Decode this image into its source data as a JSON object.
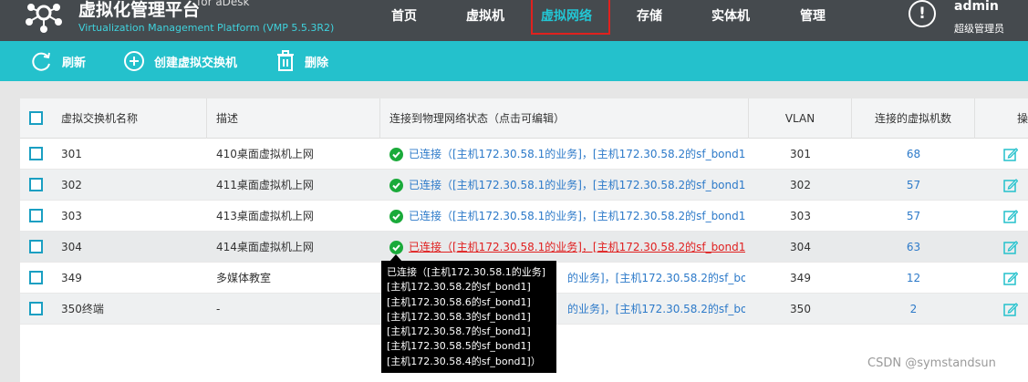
{
  "header": {
    "title": "虚拟化管理平台",
    "title_suffix": "for aDesk",
    "subtitle": "Virtualization Management Platform (VMP 5.5.3R2)",
    "nav": [
      "首页",
      "虚拟机",
      "虚拟网络",
      "存储",
      "实体机",
      "管理"
    ],
    "active_nav": "虚拟网络",
    "alert_symbol": "!",
    "user_name": "admin",
    "user_role": "超级管理员"
  },
  "toolbar": {
    "refresh_label": "刷新",
    "create_label": "创建虚拟交换机",
    "delete_label": "删除"
  },
  "table": {
    "columns": [
      "虚拟交换机名称",
      "描述",
      "连接到物理网络状态（点击可编辑）",
      "VLAN",
      "连接的虚拟机数",
      "操"
    ],
    "rows": [
      {
        "name": "301",
        "desc": "410桌面虚拟机上网",
        "status": "已连接（[主机172.30.58.1的业务]，[主机172.30.58.2的sf_bond1...",
        "vlan": "301",
        "vm_count": "68"
      },
      {
        "name": "302",
        "desc": "411桌面虚拟机上网",
        "status": "已连接（[主机172.30.58.1的业务]，[主机172.30.58.2的sf_bond1...",
        "vlan": "302",
        "vm_count": "57"
      },
      {
        "name": "303",
        "desc": "413桌面虚拟机上网",
        "status": "已连接（[主机172.30.58.1的业务]，[主机172.30.58.2的sf_bond1...",
        "vlan": "303",
        "vm_count": "57"
      },
      {
        "name": "304",
        "desc": "414桌面虚拟机上网",
        "status": "已连接（[主机172.30.58.1的业务]，[主机172.30.58.2的sf_bond1...",
        "vlan": "304",
        "vm_count": "63"
      },
      {
        "name": "349",
        "desc": "多媒体教室",
        "status": "的业务]，[主机172.30.58.2的sf_bond1...",
        "vlan": "349",
        "vm_count": "12"
      },
      {
        "name": "350终端",
        "desc": "-",
        "status": "的业务]，[主机172.30.58.2的sf_bond1...",
        "vlan": "350",
        "vm_count": "2"
      }
    ]
  },
  "tooltip": {
    "lines": [
      "已连接（[主机172.30.58.1的业务]",
      "[主机172.30.58.2的sf_bond1]",
      "[主机172.30.58.6的sf_bond1]",
      "[主机172.30.58.3的sf_bond1]",
      "[主机172.30.58.7的sf_bond1]",
      "[主机172.30.58.5的sf_bond1]",
      "[主机172.30.58.4的sf_bond1]）"
    ]
  },
  "watermark": "CSDN @symstandsun",
  "colors": {
    "header_bg": "#454a4e",
    "toolbar_bg": "#24c1cc",
    "active_nav": "#22c6d4",
    "link_blue": "#2d7ac9",
    "error_red": "#e02020",
    "success_green": "#1aaa3a",
    "checkbox_border": "#1a9fc2"
  }
}
